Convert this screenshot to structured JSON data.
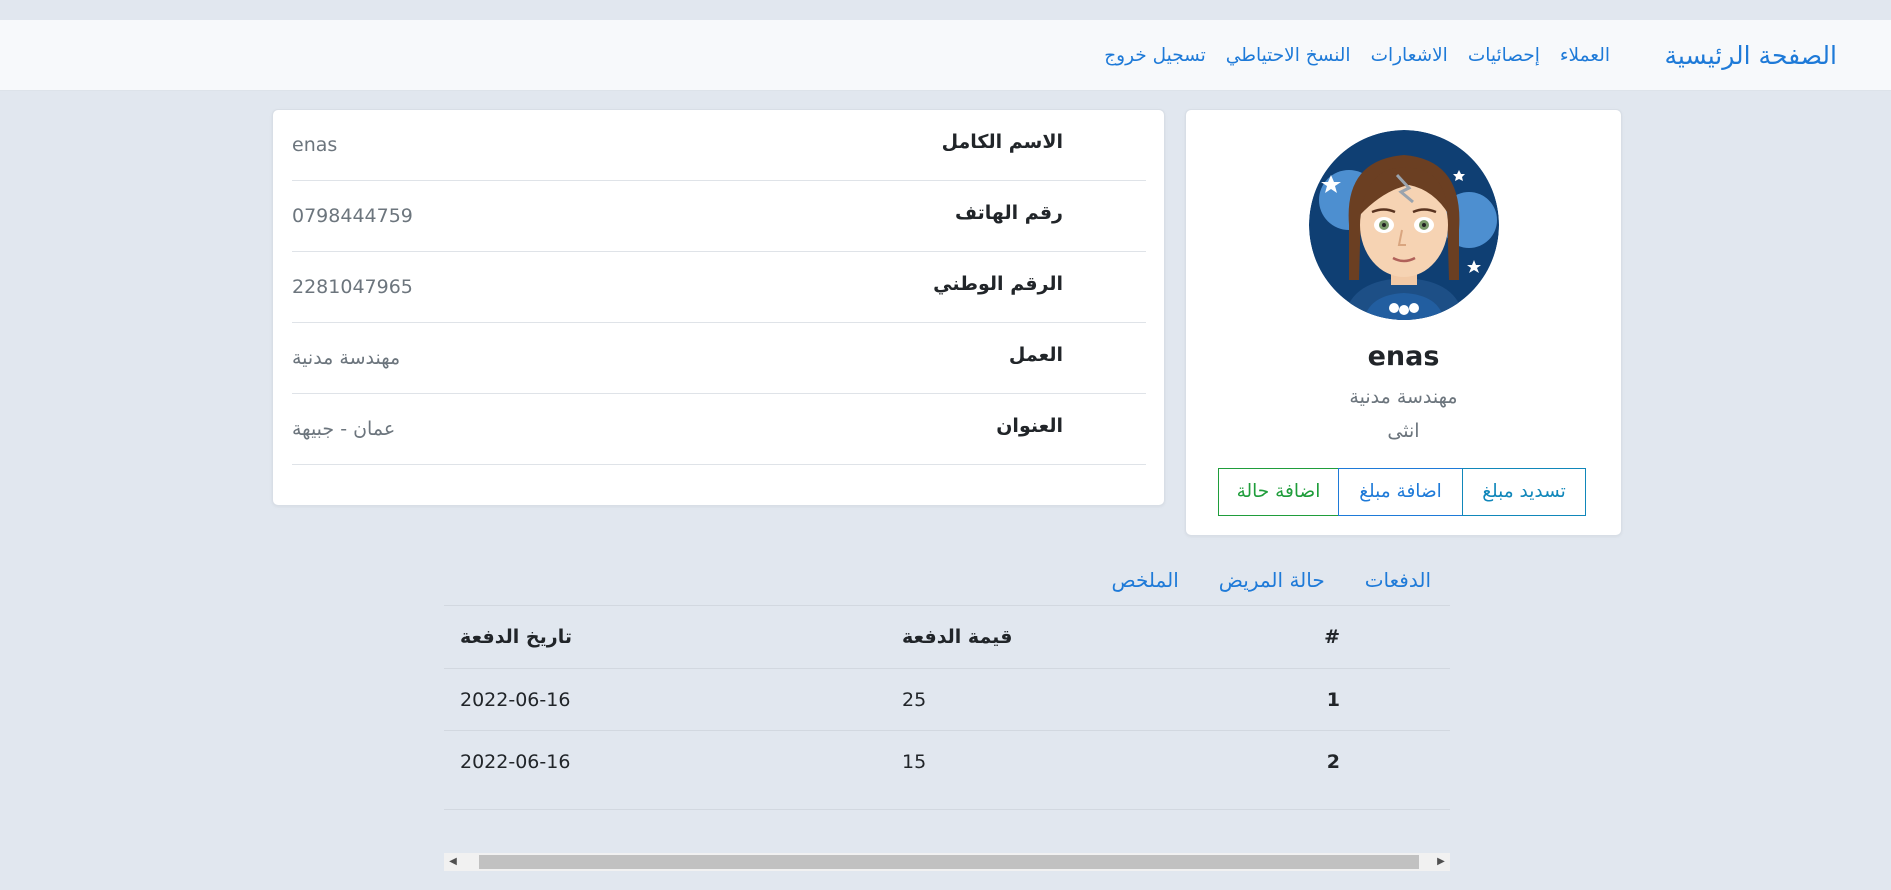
{
  "navbar": {
    "brand": "الصفحة الرئيسية",
    "links": [
      "العملاء",
      "إحصائيات",
      "الاشعارات",
      "النسخ الاحتياطي",
      "تسجيل خروج"
    ]
  },
  "profile": {
    "name": "enas",
    "job": "مهندسة مدنية",
    "gender": "انثى",
    "buttons": {
      "pay": "تسديد مبلغ",
      "add_amount": "اضافة مبلغ",
      "add_case": "اضافة حالة"
    }
  },
  "info": [
    {
      "label": "الاسم الكامل",
      "value": "enas"
    },
    {
      "label": "رقم الهاتف",
      "value": "0798444759"
    },
    {
      "label": "الرقم الوطني",
      "value": "2281047965"
    },
    {
      "label": "العمل",
      "value": "مهندسة مدنية"
    },
    {
      "label": "العنوان",
      "value": "عمان - جبيهة"
    }
  ],
  "tabs": [
    "الدفعات",
    "حالة المريض",
    "الملخص"
  ],
  "payments_table": {
    "headers": {
      "num": "#",
      "amount": "قيمة الدفعة",
      "date": "تاريخ الدفعة"
    },
    "rows": [
      {
        "num": "1",
        "amount": "25",
        "date": "2022-06-16"
      },
      {
        "num": "2",
        "amount": "15",
        "date": "2022-06-16"
      }
    ]
  },
  "colors": {
    "link": "#1e7ad8",
    "info": "#1187ba",
    "success": "#1f9d3b",
    "background": "#e1e7ef"
  }
}
